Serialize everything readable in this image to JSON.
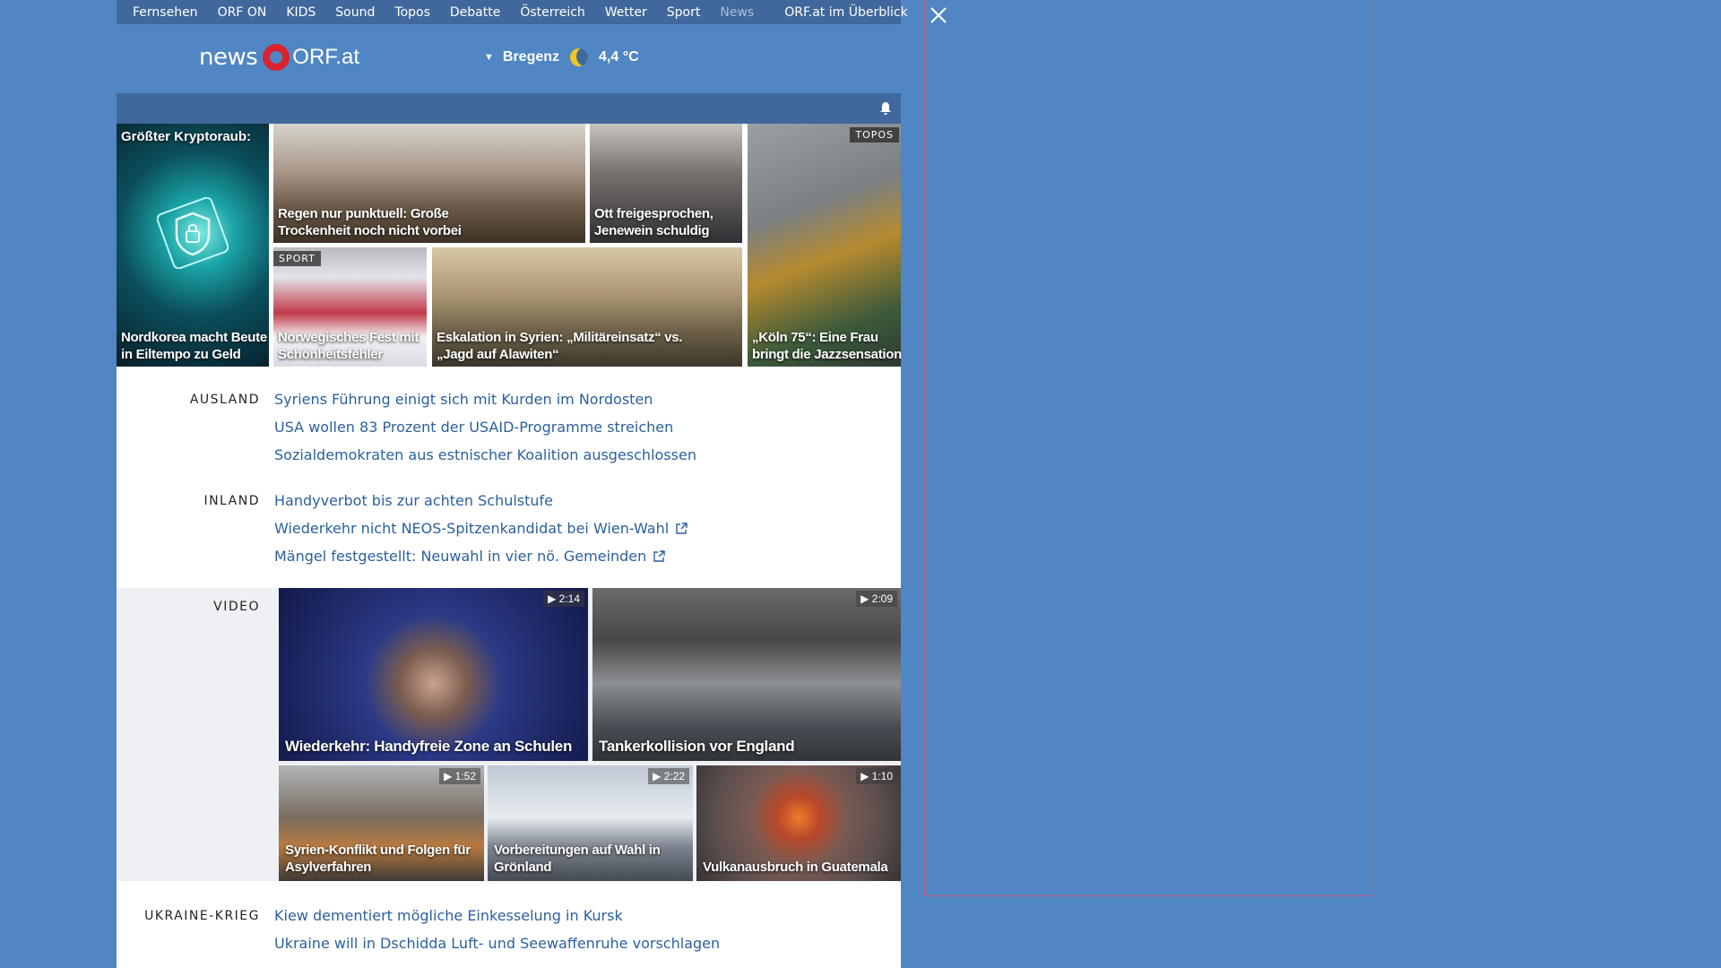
{
  "topnav": {
    "items": [
      {
        "label": "Fernsehen"
      },
      {
        "label": "ORF ON"
      },
      {
        "label": "KIDS"
      },
      {
        "label": "Sound"
      },
      {
        "label": "Topos"
      },
      {
        "label": "Debatte"
      },
      {
        "label": "Österreich"
      },
      {
        "label": "Wetter"
      },
      {
        "label": "Sport"
      },
      {
        "label": "News"
      }
    ],
    "overview": "ORF.at im Überblick"
  },
  "header": {
    "logo_news": "news",
    "logo_orf": "ORF.at",
    "weather": {
      "location": "Bregenz",
      "temperature": "4,4 °C",
      "icon": "moon-icon"
    }
  },
  "tiles": {
    "t1": {
      "top_label": "Größter Kryptoraub:",
      "caption": "Nordkorea macht Beute in Eiltempo zu Geld"
    },
    "t2": {
      "caption": "Regen nur punktuell: Große Trockenheit noch nicht vorbei"
    },
    "t3": {
      "caption": "Ott freigesprochen, Jenewein schuldig"
    },
    "t4": {
      "tag": "TOPOS",
      "caption": "„Köln 75“: Eine Frau bringt die Jazzsensation"
    },
    "t5": {
      "tag": "SPORT",
      "caption": "Norwegisches Fest mit Schönheitsfehler"
    },
    "t6": {
      "caption": "Eskalation in Syrien: „Militäreinsatz“ vs. „Jagd auf Alawiten“"
    }
  },
  "ausland": {
    "label": "AUSLAND",
    "links": [
      "Syriens Führung einigt sich mit Kurden im Nordosten",
      "USA wollen 83 Prozent der USAID-Programme streichen",
      "Sozialdemokraten aus estnischer Koalition ausgeschlossen"
    ]
  },
  "inland": {
    "label": "INLAND",
    "links": [
      "Handyverbot bis zur achten Schulstufe",
      "Wiederkehr nicht NEOS-Spitzenkandidat bei Wien-Wahl",
      "Mängel festgestellt: Neuwahl in vier nö. Gemeinden"
    ]
  },
  "video": {
    "label": "VIDEO",
    "items": [
      {
        "caption": "Wiederkehr: Handyfreie Zone an Schulen",
        "duration": "2:14"
      },
      {
        "caption": "Tankerkollision vor England",
        "duration": "2:09"
      },
      {
        "caption": "Syrien-Konflikt und Folgen für Asylverfahren",
        "duration": "1:52"
      },
      {
        "caption": "Vorbereitungen auf Wahl in Grönland",
        "duration": "2:22"
      },
      {
        "caption": "Vulkanausbruch in Guatemala",
        "duration": "1:10"
      }
    ]
  },
  "ukraine": {
    "label": "UKRAINE-KRIEG",
    "links": [
      "Kiew dementiert mögliche Einkesselung in Kursk",
      "Ukraine will in Dschidda Luft- und Seewaffenruhe vorschlagen"
    ]
  },
  "colors": {
    "background": "#5086c4",
    "nav": "#40689c",
    "link": "#2b5f9e",
    "logo_red": "#d9232f"
  }
}
